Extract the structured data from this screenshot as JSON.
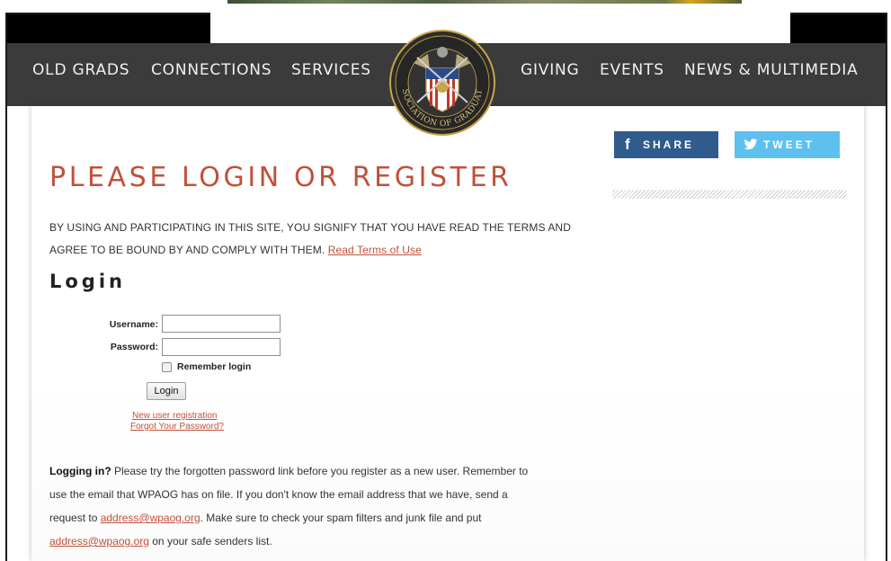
{
  "nav": {
    "items": [
      "OLD GRADS",
      "CONNECTIONS",
      "SERVICES",
      "GIVING",
      "EVENTS",
      "NEWS & MULTIMEDIA"
    ],
    "crest_text": "ASSOCIATION OF GRADUATES"
  },
  "social": {
    "share_icon": "f",
    "share_label": "SHARE",
    "tweet_icon": "twitter-bird",
    "tweet_label": "TWEET",
    "share_color": "#2f5b8d",
    "tweet_color": "#5ec0ef"
  },
  "page": {
    "title": "PLEASE LOGIN OR REGISTER",
    "terms_line1": "BY USING AND PARTICIPATING IN THIS SITE, YOU SIGNIFY THAT YOU HAVE READ THE TERMS AND",
    "terms_line2": "AGREE TO BE BOUND BY AND COMPLY WITH THEM.",
    "terms_link": "Read Terms of Use",
    "accent_color": "#c0513a"
  },
  "login": {
    "heading": "Login",
    "username_label": "Username:",
    "username_value": "",
    "password_label": "Password:",
    "password_value": "",
    "remember_label": "Remember login",
    "remember_checked": false,
    "button_label": "Login",
    "new_user_link": "New user registration",
    "forgot_link": "Forgot Your Password?"
  },
  "info": {
    "bold_lead": "Logging in?",
    "line1_rest": " Please try the forgotten password link before you register as a new user.  Remember to",
    "line2": "use the email that WPAOG has on file. If you don't know the email address that we have, send a",
    "line3_pre": "request to ",
    "email": "address@wpaog.org",
    "line3_post": ".  Make sure to check your spam filters and junk file and put",
    "line4_email": "address@wpaog.org",
    "line4_post": " on your safe senders list."
  }
}
